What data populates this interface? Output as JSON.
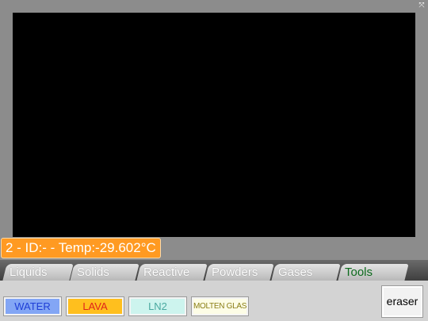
{
  "window": {
    "fullscreen_icon": "fullscreen-icon",
    "fullscreen_glyph": "⤧"
  },
  "status": {
    "text": "2 - ID:- - Temp:-29.602°C"
  },
  "tabs": [
    {
      "label": "Liquids",
      "active": false
    },
    {
      "label": "Solids",
      "active": false
    },
    {
      "label": "Reactive",
      "active": false
    },
    {
      "label": "Powders",
      "active": false
    },
    {
      "label": "Gases",
      "active": false
    },
    {
      "label": "Tools",
      "active": true
    }
  ],
  "elements": [
    {
      "label": "WATER",
      "bg": "#83a6f5",
      "color": "#1f3fd6"
    },
    {
      "label": "LAVA",
      "bg": "#ffbf1e",
      "color": "#e0241b"
    },
    {
      "label": "LN2",
      "bg": "#cdf4ee",
      "color": "#4aa9a0"
    },
    {
      "label": "MOLTEN GLASS",
      "bg": "#fdfde6",
      "color": "#8a7e16"
    }
  ],
  "eraser": {
    "label": "eraser"
  },
  "colors": {
    "background": "#8c8c8c",
    "canvas": "#000000",
    "status_bg": "#ff9a22",
    "active_tab_text": "#0d6b1d"
  }
}
